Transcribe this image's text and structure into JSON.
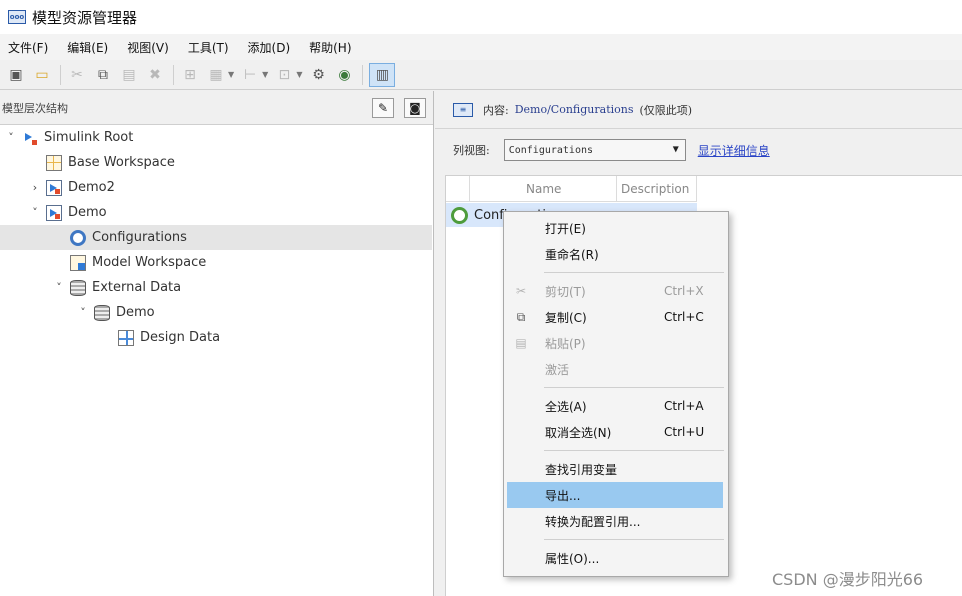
{
  "window": {
    "title": "模型资源管理器"
  },
  "menu": [
    "文件(F)",
    "编辑(E)",
    "视图(V)",
    "工具(T)",
    "添加(D)",
    "帮助(H)"
  ],
  "left": {
    "title": "模型层次结构",
    "tree": [
      {
        "label": "Simulink Root",
        "caret": "˅",
        "icon": "simulink-root-icon"
      },
      {
        "label": "Base Workspace",
        "caret": "",
        "icon": "workspace-icon"
      },
      {
        "label": "Demo2",
        "caret": "›",
        "icon": "model-icon"
      },
      {
        "label": "Demo",
        "caret": "˅",
        "icon": "model-icon"
      },
      {
        "label": "Configurations",
        "caret": "",
        "icon": "configuration-icon",
        "selected": true
      },
      {
        "label": "Model Workspace",
        "caret": "",
        "icon": "model-workspace-icon"
      },
      {
        "label": "External Data",
        "caret": "˅",
        "icon": "database-icon"
      },
      {
        "label": "Demo",
        "caret": "˅",
        "icon": "database-icon"
      },
      {
        "label": "Design Data",
        "caret": "",
        "icon": "design-data-icon"
      }
    ]
  },
  "right": {
    "content_label": "内容:",
    "content_path": "Demo/Configurations",
    "content_suffix": "(仅限此项)",
    "view_label": "列视图:",
    "view_value": "Configurations",
    "detail_link": "显示详细信息",
    "columns": [
      "Name",
      "Description"
    ],
    "row_label": "Configuration"
  },
  "context_menu": {
    "items": [
      {
        "label": "打开(E)",
        "key": "",
        "icon": "",
        "disabled": false
      },
      {
        "label": "重命名(R)",
        "key": "",
        "icon": "",
        "disabled": false
      },
      {
        "label": "剪切(T)",
        "key": "Ctrl+X",
        "icon": "✂",
        "disabled": true
      },
      {
        "label": "复制(C)",
        "key": "Ctrl+C",
        "icon": "⧉",
        "disabled": false
      },
      {
        "label": "粘贴(P)",
        "key": "",
        "icon": "📋",
        "disabled": true
      },
      {
        "label": "激活",
        "key": "",
        "icon": "",
        "disabled": true
      },
      {
        "label": "全选(A)",
        "key": "Ctrl+A",
        "icon": "",
        "disabled": false
      },
      {
        "label": "取消全选(N)",
        "key": "Ctrl+U",
        "icon": "",
        "disabled": false
      },
      {
        "label": "查找引用变量",
        "key": "",
        "icon": "",
        "disabled": false
      },
      {
        "label": "导出...",
        "key": "",
        "icon": "",
        "disabled": false,
        "highlight": true
      },
      {
        "label": "转换为配置引用...",
        "key": "",
        "icon": "",
        "disabled": false
      },
      {
        "label": "属性(O)...",
        "key": "",
        "icon": "",
        "disabled": false
      }
    ]
  },
  "watermark": "CSDN @漫步阳光66",
  "colors": {
    "selection": "#99c9f0",
    "link": "#2b45c6",
    "row_selected": "#d8e7fb"
  }
}
